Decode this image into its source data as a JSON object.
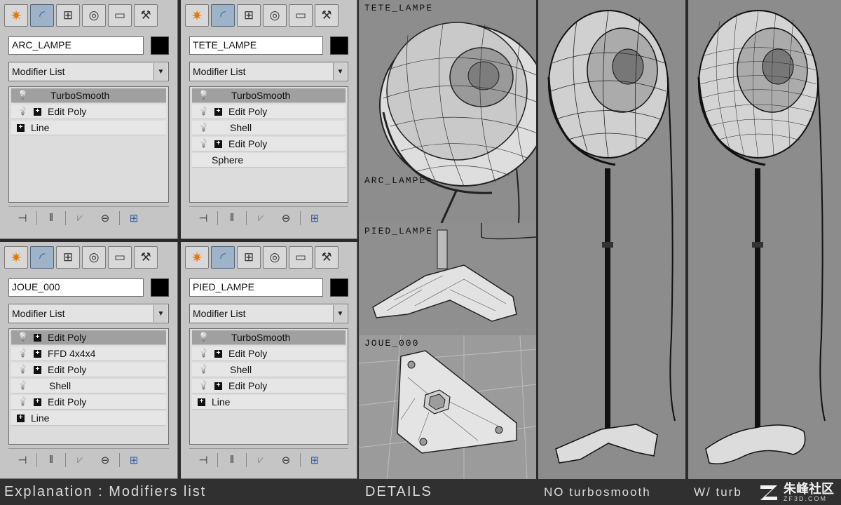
{
  "tabs": [
    {
      "icon": "create-icon",
      "glyph": "✷"
    },
    {
      "icon": "modify-icon",
      "glyph": "◜"
    },
    {
      "icon": "hierarchy-icon",
      "glyph": "⊞"
    },
    {
      "icon": "motion-icon",
      "glyph": "◎"
    },
    {
      "icon": "display-icon",
      "glyph": "▭"
    },
    {
      "icon": "utilities-icon",
      "glyph": "⚒"
    }
  ],
  "toolbar": {
    "pin": "⊣",
    "show_end": "‖",
    "make_unique": "⩗",
    "remove": "⊖",
    "configure": "⊞"
  },
  "panels": [
    {
      "object_name": "ARC_LAMPE",
      "modifier_list": "Modifier List",
      "stack": [
        {
          "label": "TurboSmooth",
          "bulb": true,
          "plus": false,
          "selected": true
        },
        {
          "label": "Edit Poly",
          "bulb": true,
          "plus": true,
          "selected": false
        },
        {
          "label": "Line",
          "bulb": false,
          "plus": true,
          "selected": false
        }
      ]
    },
    {
      "object_name": "TETE_LAMPE",
      "modifier_list": "Modifier List",
      "stack": [
        {
          "label": "TurboSmooth",
          "bulb": true,
          "plus": false,
          "selected": true
        },
        {
          "label": "Edit Poly",
          "bulb": true,
          "plus": true,
          "selected": false
        },
        {
          "label": "Shell",
          "bulb": true,
          "plus": false,
          "selected": false
        },
        {
          "label": "Edit Poly",
          "bulb": true,
          "plus": true,
          "selected": false
        },
        {
          "label": "Sphere",
          "bulb": false,
          "plus": false,
          "selected": false
        }
      ]
    },
    {
      "object_name": "JOUE_000",
      "modifier_list": "Modifier List",
      "stack": [
        {
          "label": "Edit Poly",
          "bulb": true,
          "plus": true,
          "selected": true
        },
        {
          "label": "FFD 4x4x4",
          "bulb": true,
          "plus": true,
          "selected": false
        },
        {
          "label": "Edit Poly",
          "bulb": true,
          "plus": true,
          "selected": false
        },
        {
          "label": "Shell",
          "bulb": true,
          "plus": false,
          "selected": false
        },
        {
          "label": "Edit Poly",
          "bulb": true,
          "plus": true,
          "selected": false
        },
        {
          "label": "Line",
          "bulb": false,
          "plus": true,
          "selected": false
        }
      ]
    },
    {
      "object_name": "PIED_LAMPE",
      "modifier_list": "Modifier List",
      "stack": [
        {
          "label": "TurboSmooth",
          "bulb": true,
          "plus": false,
          "selected": true
        },
        {
          "label": "Edit Poly",
          "bulb": true,
          "plus": true,
          "selected": false
        },
        {
          "label": "Shell",
          "bulb": true,
          "plus": false,
          "selected": false
        },
        {
          "label": "Edit Poly",
          "bulb": true,
          "plus": true,
          "selected": false
        },
        {
          "label": "Line",
          "bulb": false,
          "plus": true,
          "selected": false
        }
      ]
    }
  ],
  "viewports": {
    "tete_label": "TETE_LAMPE",
    "arc_label": "ARC_LAMPE",
    "pied_label": "PIED_LAMPE",
    "joue_label": "JOUE_000"
  },
  "captions": {
    "explanation": "Explanation : Modifiers list",
    "details": "DETAILS",
    "no_turbo": "NO turbosmooth",
    "with_turbo": "W/ turb"
  },
  "watermark": {
    "text": "朱峰社区",
    "sub": "ZF3D.COM"
  }
}
